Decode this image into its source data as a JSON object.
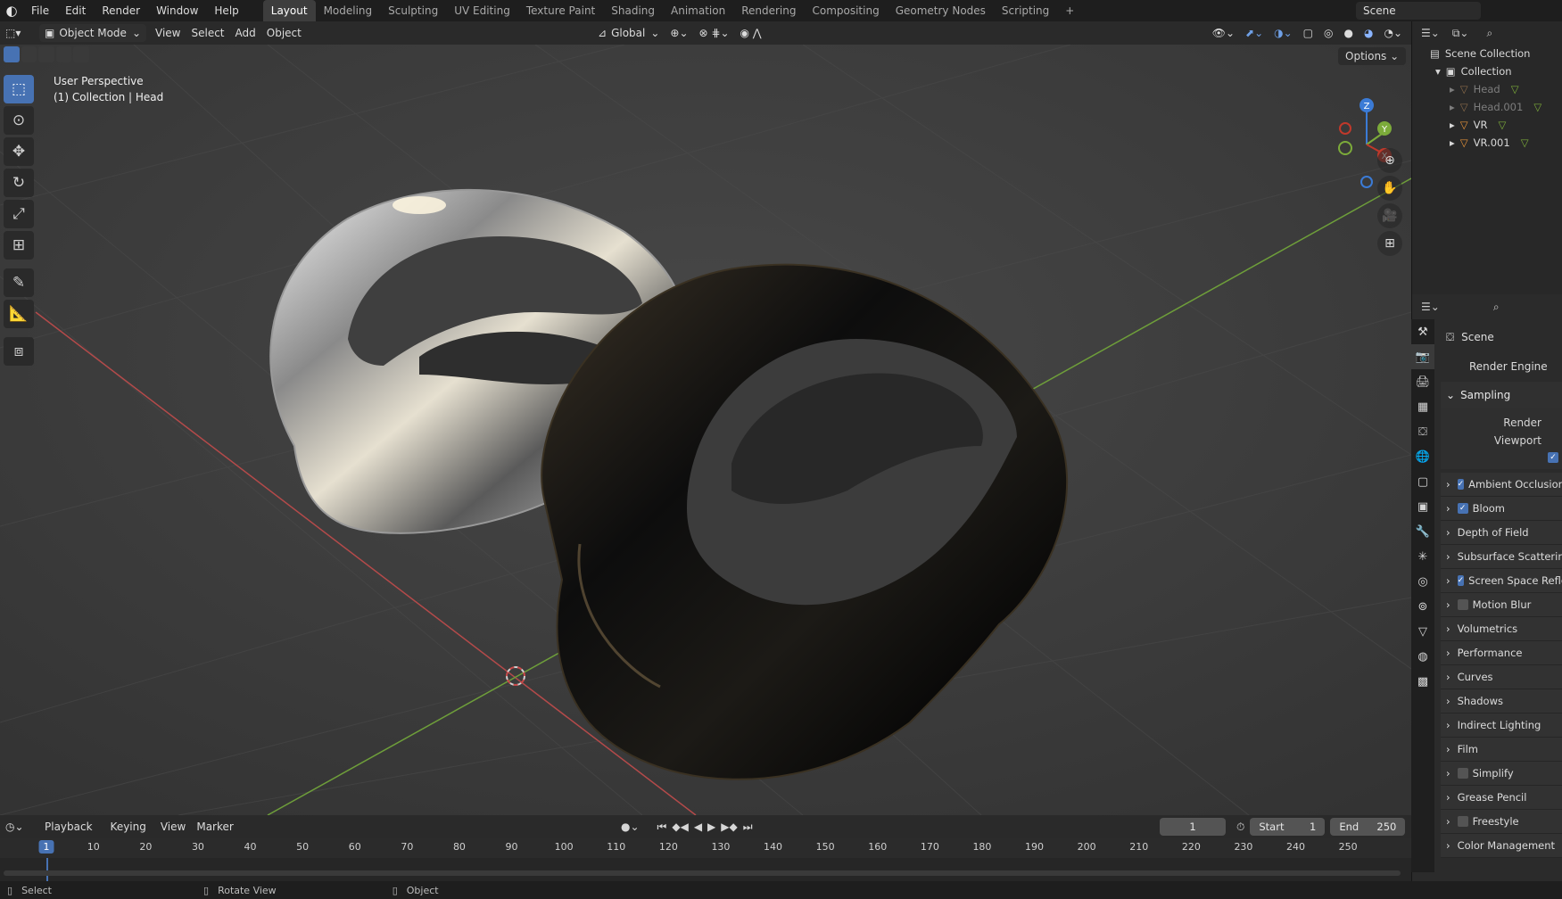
{
  "app": {
    "logo": "blender-logo-icon"
  },
  "top_menu": [
    "File",
    "Edit",
    "Render",
    "Window",
    "Help"
  ],
  "workspaces": [
    "Layout",
    "Modeling",
    "Sculpting",
    "UV Editing",
    "Texture Paint",
    "Shading",
    "Animation",
    "Rendering",
    "Compositing",
    "Geometry Nodes",
    "Scripting"
  ],
  "active_workspace": "Layout",
  "add_workspace": "+",
  "scene_name": "Scene",
  "viewport_header": {
    "mode": "Object Mode",
    "menus": [
      "View",
      "Select",
      "Add",
      "Object"
    ],
    "transform_orientation": "Global",
    "options": "Options"
  },
  "viewport": {
    "perspective_label": "User Perspective",
    "context_label": "(1) Collection | Head",
    "gizmo": {
      "x": "X",
      "y": "Y",
      "z": "Z"
    }
  },
  "tools": [
    "select-box-icon",
    "cursor-icon",
    "move-icon",
    "rotate-icon",
    "scale-icon",
    "transform-icon",
    "annotate-icon",
    "measure-icon",
    "add-cube-icon"
  ],
  "outliner": {
    "root": "Scene Collection",
    "collection": "Collection",
    "objects": [
      {
        "name": "Head",
        "dim": true
      },
      {
        "name": "Head.001",
        "dim": true
      },
      {
        "name": "VR",
        "dim": false
      },
      {
        "name": "VR.001",
        "dim": false
      }
    ]
  },
  "properties": {
    "context": "Scene",
    "render_engine_label": "Render Engine",
    "sampling": "Sampling",
    "render_label": "Render",
    "viewport_label": "Viewport",
    "panels": [
      {
        "label": "Ambient Occlusion",
        "check": "on"
      },
      {
        "label": "Bloom",
        "check": "on"
      },
      {
        "label": "Depth of Field",
        "check": "none"
      },
      {
        "label": "Subsurface Scattering",
        "check": "none"
      },
      {
        "label": "Screen Space Reflections",
        "check": "on"
      },
      {
        "label": "Motion Blur",
        "check": "off"
      },
      {
        "label": "Volumetrics",
        "check": "none"
      },
      {
        "label": "Performance",
        "check": "none"
      },
      {
        "label": "Curves",
        "check": "none"
      },
      {
        "label": "Shadows",
        "check": "none"
      },
      {
        "label": "Indirect Lighting",
        "check": "none"
      },
      {
        "label": "Film",
        "check": "none"
      },
      {
        "label": "Simplify",
        "check": "off"
      },
      {
        "label": "Grease Pencil",
        "check": "none"
      },
      {
        "label": "Freestyle",
        "check": "off"
      },
      {
        "label": "Color Management",
        "check": "none"
      }
    ]
  },
  "timeline": {
    "menus": [
      "Playback",
      "Keying",
      "View",
      "Marker"
    ],
    "current_frame": "1",
    "start_label": "Start",
    "start": "1",
    "end_label": "End",
    "end": "250",
    "ticks": [
      "1",
      "10",
      "20",
      "30",
      "40",
      "50",
      "60",
      "70",
      "80",
      "90",
      "100",
      "110",
      "120",
      "130",
      "140",
      "150",
      "160",
      "170",
      "180",
      "190",
      "200",
      "210",
      "220",
      "230",
      "240",
      "250"
    ]
  },
  "statusbar": {
    "select": "Select",
    "rotate": "Rotate View",
    "object": "Object"
  },
  "colors": {
    "accent": "#4772b3",
    "x_axis": "#c0392b",
    "y_axis": "#7cab3a",
    "z_axis": "#3b7bd6"
  }
}
